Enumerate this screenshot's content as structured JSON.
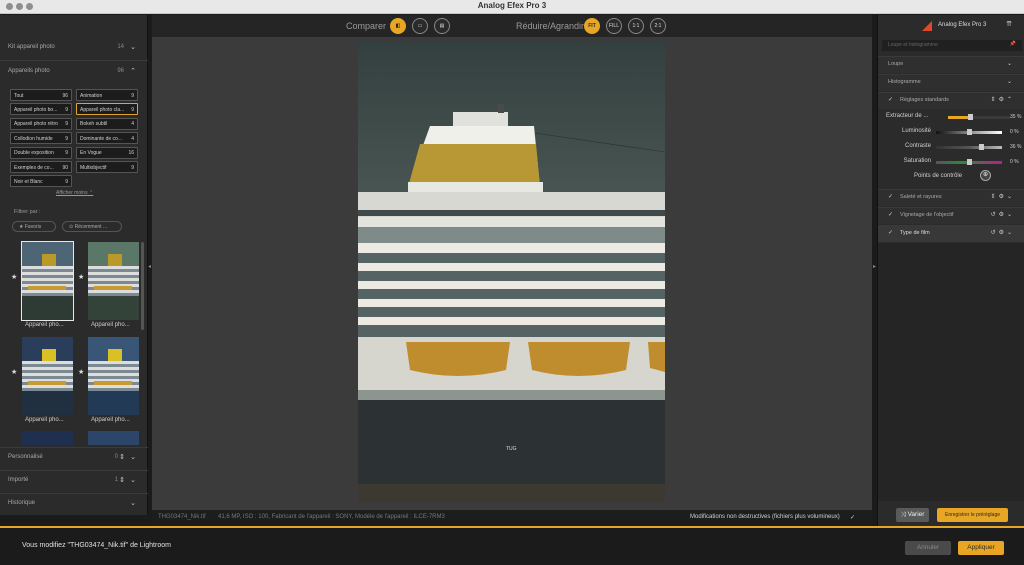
{
  "window": {
    "title": "Analog Efex Pro 3"
  },
  "left": {
    "sections_top": [
      {
        "label": "Kit appareil photo",
        "count": "14"
      },
      {
        "label": "Appareils photo",
        "count": "96"
      }
    ],
    "categories": [
      {
        "name": "Tout",
        "count": "96"
      },
      {
        "name": "Animation",
        "count": "9"
      },
      {
        "name": "Appareil photo bo...",
        "count": "9"
      },
      {
        "name": "Appareil photo cla...",
        "count": "9"
      },
      {
        "name": "Appareil photo rétro",
        "count": "9"
      },
      {
        "name": "Bokeh subtil",
        "count": "4"
      },
      {
        "name": "Collodion humide",
        "count": "9"
      },
      {
        "name": "Dominante de co...",
        "count": "4"
      },
      {
        "name": "Double exposition",
        "count": "9"
      },
      {
        "name": "En Vogue",
        "count": "16"
      },
      {
        "name": "Exemples de co...",
        "count": "90"
      },
      {
        "name": "Multiobjectif",
        "count": "9"
      },
      {
        "name": "Noir et Blanc",
        "count": "9"
      }
    ],
    "show_fewer": "Afficher moins",
    "filter_label": "Filtrer par :",
    "filters": [
      "Favoris",
      "Récemment ..."
    ],
    "thumb_caption": "Appareil pho...",
    "sections_bottom": [
      {
        "label": "Personnalisé",
        "count": "0"
      },
      {
        "label": "Importé",
        "count": "1"
      },
      {
        "label": "Historique",
        "count": ""
      }
    ]
  },
  "topbar": {
    "compare_label": "Comparer",
    "zoom_label": "Réduire/Agrandir",
    "zoom_buttons": [
      "FIT",
      "FILL",
      "1:1",
      "2:1"
    ]
  },
  "infobar": {
    "file": "THG03474_Nik.tif",
    "meta": "41,6 MP, ISO : 100, Fabricant de l'appareil : SONY, Modèle de l'appareil : ILCE-7RM3",
    "nondestructive": "Modifications non destructives (fichiers plus volumineux)"
  },
  "photo": {
    "hull_label": "TUG"
  },
  "right": {
    "app_name": "Analog Efex Pro 3",
    "search_placeholder": "Loupe et histogramme",
    "sections": [
      "Loupe",
      "Histogramme"
    ],
    "standard_settings": "Réglages standards",
    "sliders": [
      {
        "label": "Extracteur de ...",
        "value": 35,
        "display": "35 %"
      },
      {
        "label": "Luminosité",
        "value": 0,
        "display": "0 %"
      },
      {
        "label": "Contraste",
        "value": 36,
        "display": "36 %"
      },
      {
        "label": "Saturation",
        "value": 0,
        "display": "0 %"
      }
    ],
    "control_points": "Points de contrôle",
    "panels": [
      "Saleté et rayures",
      "Vignetage de l'objectif",
      "Type de film"
    ],
    "vary_button": "Varier",
    "save_preset_button": "Enregistrer le préréglage"
  },
  "bottom": {
    "message": "Vous modifiez \"THG03474_Nik.tif\" de Lightroom",
    "cancel": "Annuler",
    "apply": "Appliquer"
  },
  "colors": {
    "accent": "#e8a624"
  }
}
